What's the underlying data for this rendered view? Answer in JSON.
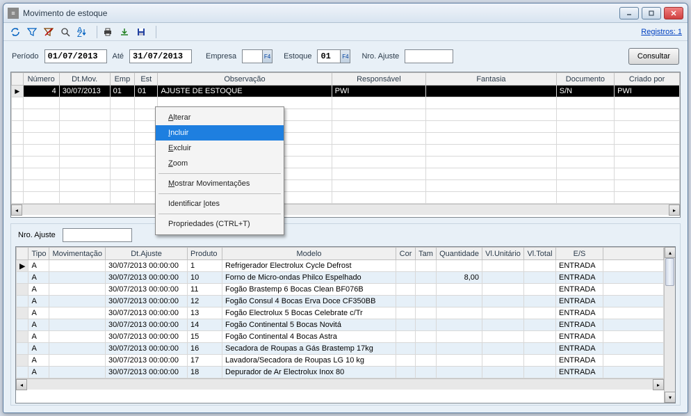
{
  "window": {
    "title": "Movimento de estoque"
  },
  "toolbar": {
    "registros_label": "Registros: 1"
  },
  "filters": {
    "periodo_label": "Período",
    "periodo_start": "01/07/2013",
    "ate_label": "Até",
    "periodo_end": "31/07/2013",
    "empresa_label": "Empresa",
    "empresa_value": "",
    "estoque_label": "Estoque",
    "estoque_value": "01",
    "nro_ajuste_label": "Nro. Ajuste",
    "nro_ajuste_value": "",
    "consultar_label": "Consultar"
  },
  "main_grid": {
    "headers": [
      "Número",
      "Dt.Mov.",
      "Emp",
      "Est",
      "Observação",
      "Responsável",
      "Fantasia",
      "Documento",
      "Criado por"
    ],
    "row": {
      "numero": "4",
      "dtmov": "30/07/2013",
      "emp": "01",
      "est": "01",
      "observacao": "AJUSTE DE ESTOQUE",
      "responsavel": "PWI",
      "fantasia": "",
      "documento": "S/N",
      "criado_por": "PWI"
    }
  },
  "context_menu": {
    "alterar": "Alterar",
    "incluir": "Incluir",
    "excluir": "Excluir",
    "zoom": "Zoom",
    "mostrar": "Mostrar Movimentações",
    "lotes": "Identificar lotes",
    "propriedades": "Propriedades (CTRL+T)"
  },
  "lower": {
    "nro_ajuste_label": "Nro. Ajuste",
    "nro_ajuste_value": "",
    "headers": [
      "Tipo",
      "Movimentação",
      "Dt.Ajuste",
      "Produto",
      "Modelo",
      "Cor",
      "Tam",
      "Quantidade",
      "Vl.Unitário",
      "Vl.Total",
      "E/S"
    ],
    "rows": [
      {
        "tipo": "A",
        "mov": "",
        "dt": "30/07/2013 00:00:00",
        "prod": "1",
        "modelo": "Refrigerador Electrolux Cycle Defrost",
        "cor": "",
        "tam": "",
        "qtd": "",
        "vu": "",
        "vt": "",
        "es": "ENTRADA"
      },
      {
        "tipo": "A",
        "mov": "",
        "dt": "30/07/2013 00:00:00",
        "prod": "10",
        "modelo": "Forno de Micro-ondas Philco Espelhado",
        "cor": "",
        "tam": "",
        "qtd": "8,00",
        "vu": "",
        "vt": "",
        "es": "ENTRADA"
      },
      {
        "tipo": "A",
        "mov": "",
        "dt": "30/07/2013 00:00:00",
        "prod": "11",
        "modelo": "Fogão Brastemp 6 Bocas Clean BF076B",
        "cor": "",
        "tam": "",
        "qtd": "",
        "vu": "",
        "vt": "",
        "es": "ENTRADA"
      },
      {
        "tipo": "A",
        "mov": "",
        "dt": "30/07/2013 00:00:00",
        "prod": "12",
        "modelo": "Fogão Consul 4 Bocas Erva Doce CF350BB",
        "cor": "",
        "tam": "",
        "qtd": "",
        "vu": "",
        "vt": "",
        "es": "ENTRADA"
      },
      {
        "tipo": "A",
        "mov": "",
        "dt": "30/07/2013 00:00:00",
        "prod": "13",
        "modelo": "Fogão Electrolux 5 Bocas Celebrate c/Tr",
        "cor": "",
        "tam": "",
        "qtd": "",
        "vu": "",
        "vt": "",
        "es": "ENTRADA"
      },
      {
        "tipo": "A",
        "mov": "",
        "dt": "30/07/2013 00:00:00",
        "prod": "14",
        "modelo": "Fogão Continental 5 Bocas Novitá",
        "cor": "",
        "tam": "",
        "qtd": "",
        "vu": "",
        "vt": "",
        "es": "ENTRADA"
      },
      {
        "tipo": "A",
        "mov": "",
        "dt": "30/07/2013 00:00:00",
        "prod": "15",
        "modelo": "Fogão Continental 4 Bocas Astra",
        "cor": "",
        "tam": "",
        "qtd": "",
        "vu": "",
        "vt": "",
        "es": "ENTRADA"
      },
      {
        "tipo": "A",
        "mov": "",
        "dt": "30/07/2013 00:00:00",
        "prod": "16",
        "modelo": "Secadora de Roupas a Gás Brastemp 17kg",
        "cor": "",
        "tam": "",
        "qtd": "",
        "vu": "",
        "vt": "",
        "es": "ENTRADA"
      },
      {
        "tipo": "A",
        "mov": "",
        "dt": "30/07/2013 00:00:00",
        "prod": "17",
        "modelo": "Lavadora/Secadora de Roupas LG 10 kg",
        "cor": "",
        "tam": "",
        "qtd": "",
        "vu": "",
        "vt": "",
        "es": "ENTRADA"
      },
      {
        "tipo": "A",
        "mov": "",
        "dt": "30/07/2013 00:00:00",
        "prod": "18",
        "modelo": "Depurador de Ar Electrolux Inox 80",
        "cor": "",
        "tam": "",
        "qtd": "",
        "vu": "",
        "vt": "",
        "es": "ENTRADA"
      }
    ]
  }
}
